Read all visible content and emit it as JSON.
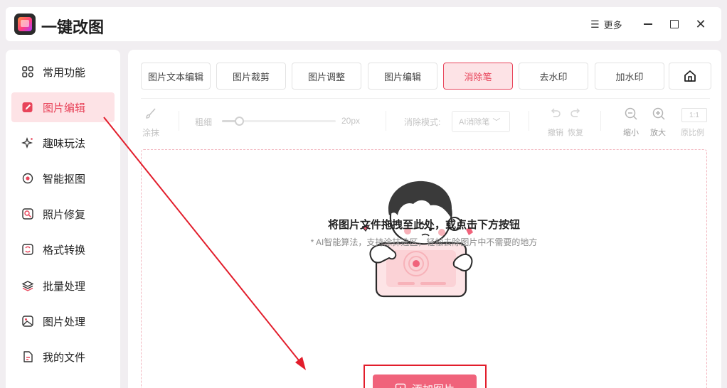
{
  "app": {
    "title": "一键改图",
    "more_label": "更多",
    "more_icon": "☰"
  },
  "sidebar": {
    "items": [
      {
        "label": "常用功能",
        "icon": "grid-icon"
      },
      {
        "label": "图片编辑",
        "icon": "edit-icon",
        "active": true
      },
      {
        "label": "趣味玩法",
        "icon": "sparkle-icon"
      },
      {
        "label": "智能抠图",
        "icon": "target-icon"
      },
      {
        "label": "照片修复",
        "icon": "repair-icon"
      },
      {
        "label": "格式转换",
        "icon": "convert-icon"
      },
      {
        "label": "批量处理",
        "icon": "layers-icon"
      },
      {
        "label": "图片处理",
        "icon": "image-icon"
      },
      {
        "label": "我的文件",
        "icon": "file-icon"
      }
    ]
  },
  "tabs": [
    {
      "label": "图片文本编辑"
    },
    {
      "label": "图片裁剪"
    },
    {
      "label": "图片调整"
    },
    {
      "label": "图片编辑"
    },
    {
      "label": "消除笔",
      "active": true
    },
    {
      "label": "去水印"
    },
    {
      "label": "加水印"
    }
  ],
  "toolbar": {
    "brush_label": "涂抹",
    "thickness_label": "粗细",
    "thickness_value": "20px",
    "thickness_fraction": 0.15,
    "mode_label": "消除模式:",
    "mode_value": "AI消除笔",
    "undo_label": "撤销",
    "redo_label": "恢复",
    "zoom_out_label": "缩小",
    "zoom_in_label": "放大",
    "ratio_box": "1:1",
    "ratio_label": "原比例"
  },
  "dropzone": {
    "title": "将图片文件拖拽至此处，或点击下方按钮",
    "subtitle": "* AI智能算法，支持涂抹选区，轻松去除图片中不需要的地方",
    "button_label": "添加图片"
  },
  "colors": {
    "accent": "#e8445a",
    "accent_bg": "#fde3e6",
    "button": "#f0637b",
    "annotation": "#e21d2b"
  }
}
